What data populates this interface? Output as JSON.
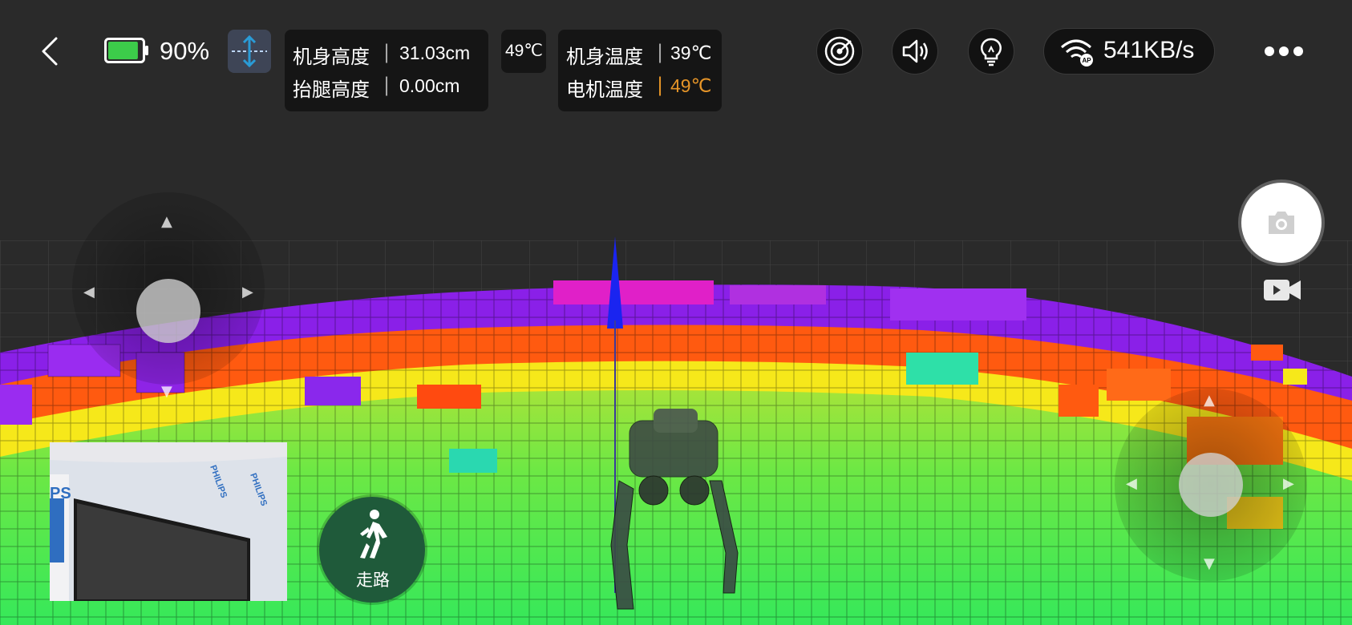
{
  "status": {
    "battery_percent": "90%",
    "battery_level": 0.9,
    "body_height_label": "机身高度",
    "body_height_value": "31.03cm",
    "leg_lift_label": "抬腿高度",
    "leg_lift_value": "0.00cm",
    "temp_badge": "49℃",
    "body_temp_label": "机身温度",
    "body_temp_value": "39℃",
    "motor_temp_label": "电机温度",
    "motor_temp_value": "49℃",
    "network_speed": "541KB/s",
    "wifi_mode": "AP"
  },
  "controls": {
    "mode_label": "走路"
  },
  "camera_preview": {
    "brand_text": "PHILIPS",
    "brand_fragment": "PS"
  },
  "colors": {
    "accent_orange": "#e69528",
    "battery_green": "#3ccc4a",
    "mode_button": "#1f5a3a",
    "stair_icon": "#2a9bd6"
  },
  "icons": [
    "back-arrow-icon",
    "battery-icon",
    "stair-height-icon",
    "radar-icon",
    "speaker-icon",
    "lightbulb-icon",
    "wifi-ap-icon",
    "more-icon",
    "camera-icon",
    "video-icon",
    "walk-icon"
  ]
}
